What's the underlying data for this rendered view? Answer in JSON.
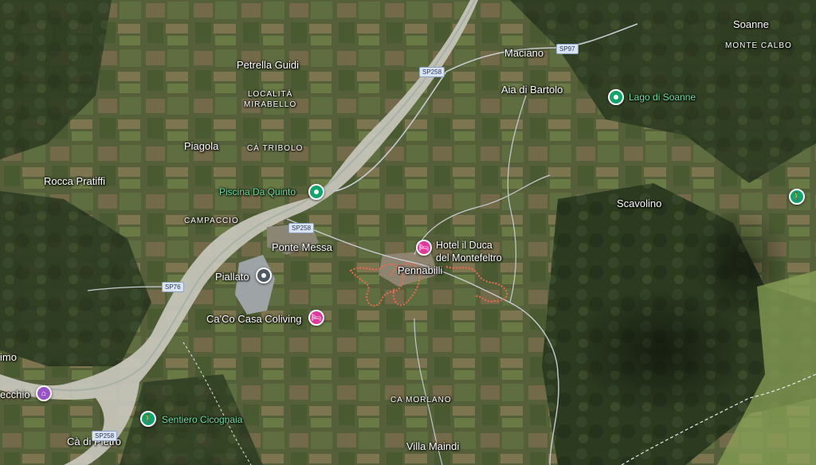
{
  "map": {
    "colors": {
      "terrain_dark": "#2f3f22",
      "terrain_mid": "#4d5a31",
      "field": "#8a7a55",
      "riverbed": "#c9c7bd",
      "trail": "#f06a55",
      "road": "#c8ccd2"
    },
    "towns": [
      {
        "id": "soanne",
        "label": "Soanne"
      },
      {
        "id": "maciano",
        "label": "Maciano"
      },
      {
        "id": "petrella-guidi",
        "label": "Petrella Guidi"
      },
      {
        "id": "aia-di-bartolo",
        "label": "Aia di Bartolo"
      },
      {
        "id": "piagola",
        "label": "Piagola"
      },
      {
        "id": "rocca-pratiffi",
        "label": "Rocca Pratiffi"
      },
      {
        "id": "scavolino",
        "label": "Scavolino"
      },
      {
        "id": "ponte-messa",
        "label": "Ponte Messa"
      },
      {
        "id": "pennabilli",
        "label": "Pennabilli"
      },
      {
        "id": "villa-maindi",
        "label": "Villa Maindi"
      },
      {
        "id": "ca-di-pietro",
        "label": "Cà di Pietro"
      },
      {
        "id": "imo",
        "label": "imo"
      }
    ],
    "areas": [
      {
        "id": "monte-calbo",
        "label": "MONTE CALBO"
      },
      {
        "id": "localita-mirabello",
        "label": "LOCALITÀ\nMIRABELLO"
      },
      {
        "id": "ca-tribolo",
        "label": "CÀ TRIBOLO"
      },
      {
        "id": "campaccio",
        "label": "CAMPACCIO"
      },
      {
        "id": "ca-morlano",
        "label": "CA MORLANO"
      }
    ],
    "pois": [
      {
        "id": "lago-di-soanne",
        "label": "Lago di Soanne",
        "category": "park",
        "icon": "pin-icon"
      },
      {
        "id": "piscina-da-quinto",
        "label": "Piscina Da Quinto",
        "category": "park",
        "icon": "pin-icon"
      },
      {
        "id": "hotel-il-duca",
        "label": "Hotel il Duca\ndel Montefeltro",
        "category": "lodging",
        "icon": "bed-icon"
      },
      {
        "id": "piallato",
        "label": "Piallato",
        "category": "place",
        "icon": "pin-icon"
      },
      {
        "id": "caco-casa-coliving",
        "label": "Ca'Co Casa Coliving",
        "category": "lodging",
        "icon": "bed-icon"
      },
      {
        "id": "sentiero-cicognaia",
        "label": "Sentiero Cicognaia",
        "category": "hiking",
        "icon": "hiker-icon"
      },
      {
        "id": "hiking-east",
        "label": "",
        "category": "hiking",
        "icon": "hiker-icon"
      },
      {
        "id": "ecchio",
        "label": "ecchio",
        "category": "worship",
        "icon": "temple-icon"
      }
    ],
    "roads": [
      {
        "id": "sp97",
        "label": "SP97"
      },
      {
        "id": "sp258-north",
        "label": "SP258"
      },
      {
        "id": "sp258-mid",
        "label": "SP258"
      },
      {
        "id": "sp76",
        "label": "SP76"
      },
      {
        "id": "sp258-south",
        "label": "SP258"
      }
    ]
  }
}
